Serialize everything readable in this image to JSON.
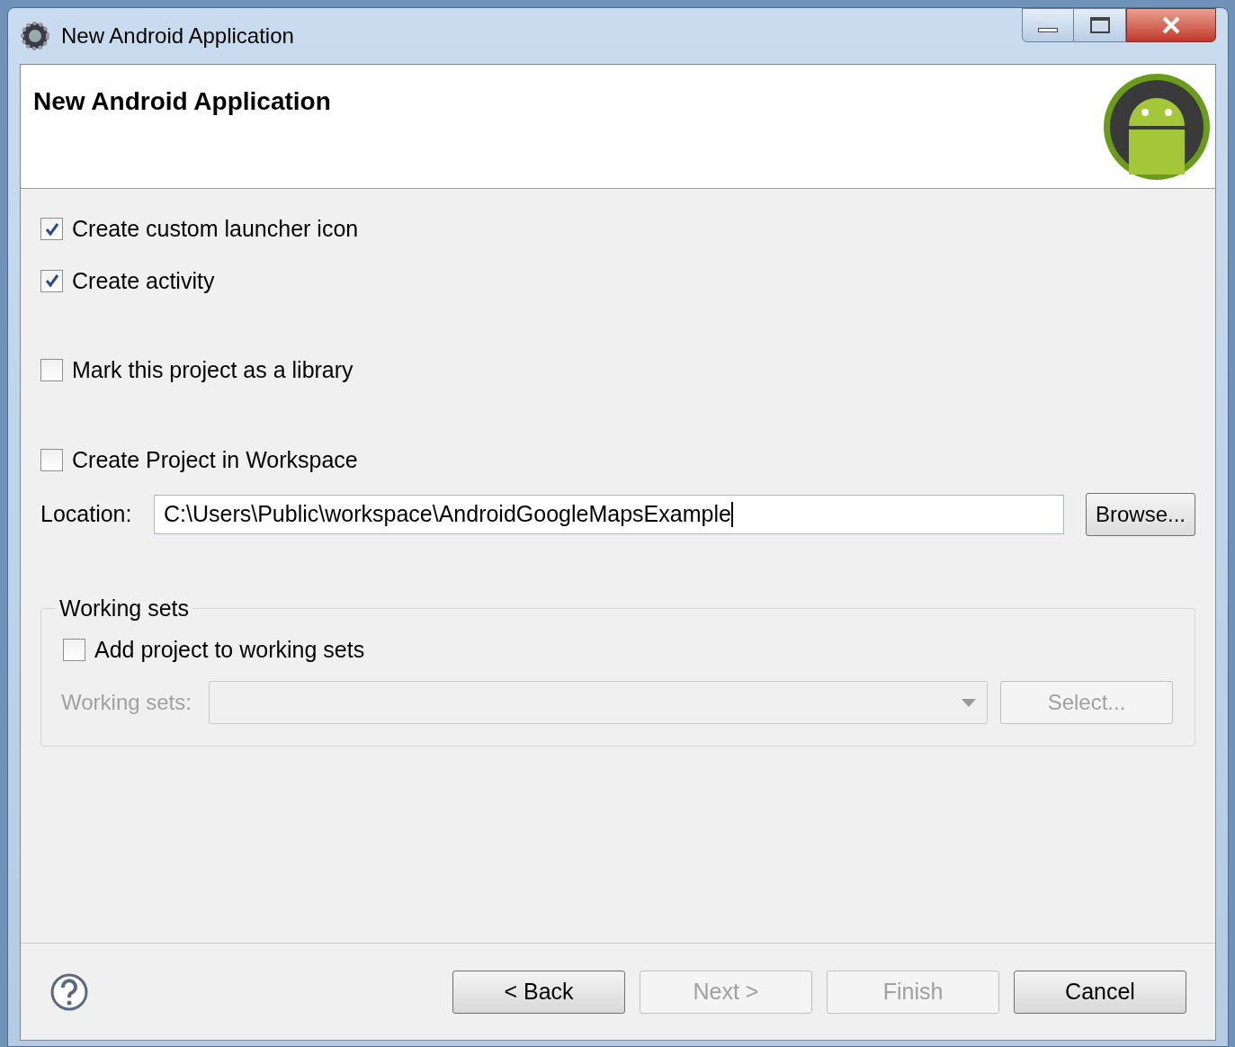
{
  "window": {
    "title": "New Android Application"
  },
  "header": {
    "title": "New Android Application"
  },
  "options": [
    {
      "label": "Create custom launcher icon",
      "checked": true
    },
    {
      "label": "Create activity",
      "checked": true
    },
    {
      "label": "Mark this project as a library",
      "checked": false
    },
    {
      "label": "Create Project in Workspace",
      "checked": false
    }
  ],
  "location": {
    "label": "Location:",
    "value": "C:\\Users\\Public\\workspace\\AndroidGoogleMapsExample",
    "button": "Browse..."
  },
  "working_sets": {
    "title": "Working sets",
    "add": {
      "label": "Add project to working sets",
      "checked": false
    },
    "field_label": "Working sets:",
    "disabled": true,
    "button": "Select..."
  },
  "buttons": [
    {
      "label": "< Back",
      "disabled": false
    },
    {
      "label": "Next >",
      "disabled": true
    },
    {
      "label": "Finish",
      "disabled": true
    },
    {
      "label": "Cancel",
      "disabled": false
    }
  ]
}
